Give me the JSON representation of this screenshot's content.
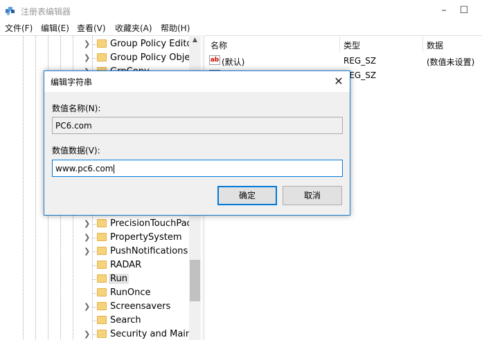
{
  "window": {
    "title": "注册表编辑器",
    "minimize_icon": "minimize-icon",
    "maximize_icon": "maximize-icon"
  },
  "menu": [
    "文件(F)",
    "编辑(E)",
    "查看(V)",
    "收藏夹(A)",
    "帮助(H)"
  ],
  "tree": {
    "items": [
      {
        "label": "Group Policy Editor"
      },
      {
        "label": "Group Policy Objec"
      },
      {
        "label": "GrpConv"
      },
      {
        "label": "PrecisionTouchPad"
      },
      {
        "label": "PropertySystem"
      },
      {
        "label": "PushNotifications"
      },
      {
        "label": "RADAR"
      },
      {
        "label": "Run",
        "selected": true
      },
      {
        "label": "RunOnce"
      },
      {
        "label": "Screensavers"
      },
      {
        "label": "Search"
      },
      {
        "label": "Security and Mainte"
      }
    ]
  },
  "values": {
    "headers": {
      "name": "名称",
      "type": "类型",
      "data": "数据"
    },
    "rows": [
      {
        "name": "(默认)",
        "type": "REG_SZ",
        "data": "(数值未设置)"
      },
      {
        "name": "",
        "type": "REG_SZ",
        "data": ""
      }
    ]
  },
  "dialog": {
    "title": "编辑字符串",
    "name_label": "数值名称(N):",
    "name_value": "PC6.com",
    "data_label": "数值数据(V):",
    "data_value": "www.pc6.com",
    "ok_label": "确定",
    "cancel_label": "取消"
  },
  "colors": {
    "accent": "#0078d7",
    "folder": "#f6d27a"
  }
}
